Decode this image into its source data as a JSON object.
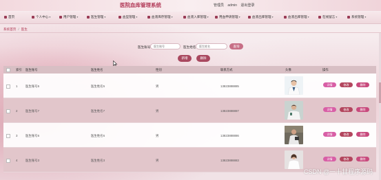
{
  "app": {
    "title": "医院血库管理系统"
  },
  "user": {
    "label": "管理员",
    "name": "admin",
    "logout": "退出登录"
  },
  "nav": [
    {
      "label": "首页"
    },
    {
      "label": "个人中心"
    },
    {
      "label": "用户管理"
    },
    {
      "label": "医生管理"
    },
    {
      "label": "血型管理"
    },
    {
      "label": "血液库存管理"
    },
    {
      "label": "血液入库管理"
    },
    {
      "label": "用血申请管理"
    },
    {
      "label": "血液出库管理"
    },
    {
      "label": "血液出库管理"
    },
    {
      "label": "在线留言"
    },
    {
      "label": "系统管理"
    }
  ],
  "breadcrumb": {
    "home": "系统首页",
    "current": "医生"
  },
  "search": {
    "field1_label": "医生账号",
    "field1_placeholder": "医生账号",
    "field2_label": "医生姓名",
    "field2_placeholder": "医生姓名",
    "button": "查询"
  },
  "actions": {
    "add": "新增",
    "delete": "删除"
  },
  "table": {
    "headers": [
      "索引",
      "医生账号",
      "医生姓名",
      "性别",
      "联系方式",
      "头像",
      "操作"
    ],
    "rows": [
      {
        "index": "1",
        "account": "医生账号5",
        "name": "医生姓名5",
        "gender": "男",
        "phone": "13823888885"
      },
      {
        "index": "2",
        "account": "医生账号7",
        "name": "医生姓名7",
        "gender": "男",
        "phone": "13823888887"
      },
      {
        "index": "3",
        "account": "医生账号6",
        "name": "医生姓名6",
        "gender": "男",
        "phone": "13823888886"
      },
      {
        "index": "4",
        "account": "医生账号3",
        "name": "医生姓名3",
        "gender": "男",
        "phone": "13823888883"
      }
    ],
    "op_labels": {
      "detail": "详情",
      "edit": "修改",
      "delete": "删除"
    }
  },
  "watermark": "CSDN @一十甘程序源码",
  "colors": {
    "brand": "#b23a58",
    "header_bg": "#d8bfc4",
    "accent": "#c76f86"
  }
}
